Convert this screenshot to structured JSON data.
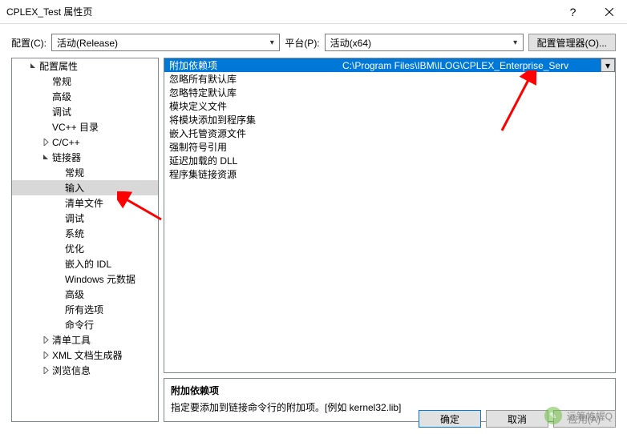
{
  "title": "CPLEX_Test 属性页",
  "top": {
    "configLabel": "配置(C):",
    "configValue": "活动(Release)",
    "platformLabel": "平台(P):",
    "platformValue": "活动(x64)",
    "cfgMgr": "配置管理器(O)..."
  },
  "tree": [
    {
      "label": "配置属性",
      "lvl": 1,
      "exp": "open"
    },
    {
      "label": "常规",
      "lvl": 2
    },
    {
      "label": "高级",
      "lvl": 2
    },
    {
      "label": "调试",
      "lvl": 2
    },
    {
      "label": "VC++ 目录",
      "lvl": 2
    },
    {
      "label": "C/C++",
      "lvl": 2,
      "exp": "closed"
    },
    {
      "label": "链接器",
      "lvl": 2,
      "exp": "open"
    },
    {
      "label": "常规",
      "lvl": 3
    },
    {
      "label": "输入",
      "lvl": 3,
      "sel": true
    },
    {
      "label": "清单文件",
      "lvl": 3
    },
    {
      "label": "调试",
      "lvl": 3
    },
    {
      "label": "系统",
      "lvl": 3
    },
    {
      "label": "优化",
      "lvl": 3
    },
    {
      "label": "嵌入的 IDL",
      "lvl": 3
    },
    {
      "label": "Windows 元数据",
      "lvl": 3
    },
    {
      "label": "高级",
      "lvl": 3
    },
    {
      "label": "所有选项",
      "lvl": 3
    },
    {
      "label": "命令行",
      "lvl": 3
    },
    {
      "label": "清单工具",
      "lvl": 2,
      "exp": "closed"
    },
    {
      "label": "XML 文档生成器",
      "lvl": 2,
      "exp": "closed"
    },
    {
      "label": "浏览信息",
      "lvl": 2,
      "exp": "closed"
    }
  ],
  "grid": [
    {
      "label": "附加依赖项",
      "value": "C:\\Program Files\\IBM\\ILOG\\CPLEX_Enterprise_Serv",
      "sel": true
    },
    {
      "label": "忽略所有默认库",
      "value": ""
    },
    {
      "label": "忽略特定默认库",
      "value": ""
    },
    {
      "label": "模块定义文件",
      "value": ""
    },
    {
      "label": "将模块添加到程序集",
      "value": ""
    },
    {
      "label": "嵌入托管资源文件",
      "value": ""
    },
    {
      "label": "强制符号引用",
      "value": ""
    },
    {
      "label": "延迟加载的 DLL",
      "value": ""
    },
    {
      "label": "程序集链接资源",
      "value": ""
    }
  ],
  "desc": {
    "header": "附加依赖项",
    "body": "指定要添加到链接命令行的附加项。[例如 kernel32.lib]"
  },
  "buttons": {
    "ok": "确定",
    "cancel": "取消",
    "apply": "应用(A)"
  },
  "watermark": "运筹帷幄Q"
}
